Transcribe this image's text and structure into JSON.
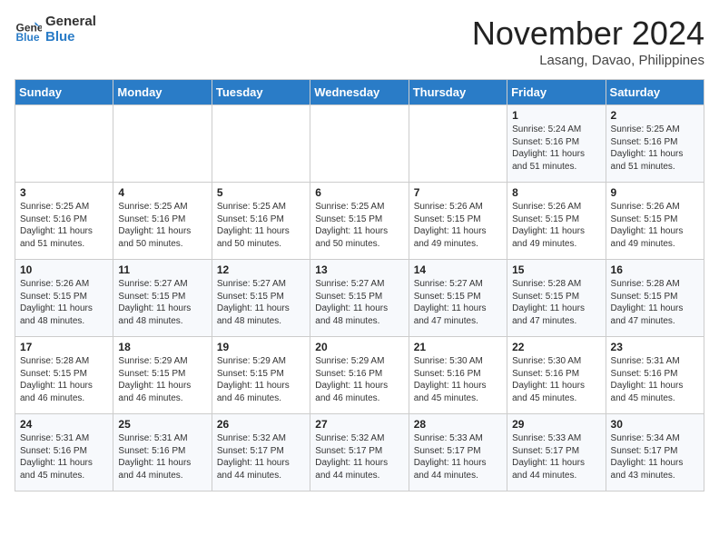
{
  "header": {
    "logo_text_general": "General",
    "logo_text_blue": "Blue",
    "month_title": "November 2024",
    "location": "Lasang, Davao, Philippines"
  },
  "weekdays": [
    "Sunday",
    "Monday",
    "Tuesday",
    "Wednesday",
    "Thursday",
    "Friday",
    "Saturday"
  ],
  "weeks": [
    [
      {
        "day": "",
        "info": ""
      },
      {
        "day": "",
        "info": ""
      },
      {
        "day": "",
        "info": ""
      },
      {
        "day": "",
        "info": ""
      },
      {
        "day": "",
        "info": ""
      },
      {
        "day": "1",
        "info": "Sunrise: 5:24 AM\nSunset: 5:16 PM\nDaylight: 11 hours\nand 51 minutes."
      },
      {
        "day": "2",
        "info": "Sunrise: 5:25 AM\nSunset: 5:16 PM\nDaylight: 11 hours\nand 51 minutes."
      }
    ],
    [
      {
        "day": "3",
        "info": "Sunrise: 5:25 AM\nSunset: 5:16 PM\nDaylight: 11 hours\nand 51 minutes."
      },
      {
        "day": "4",
        "info": "Sunrise: 5:25 AM\nSunset: 5:16 PM\nDaylight: 11 hours\nand 50 minutes."
      },
      {
        "day": "5",
        "info": "Sunrise: 5:25 AM\nSunset: 5:16 PM\nDaylight: 11 hours\nand 50 minutes."
      },
      {
        "day": "6",
        "info": "Sunrise: 5:25 AM\nSunset: 5:15 PM\nDaylight: 11 hours\nand 50 minutes."
      },
      {
        "day": "7",
        "info": "Sunrise: 5:26 AM\nSunset: 5:15 PM\nDaylight: 11 hours\nand 49 minutes."
      },
      {
        "day": "8",
        "info": "Sunrise: 5:26 AM\nSunset: 5:15 PM\nDaylight: 11 hours\nand 49 minutes."
      },
      {
        "day": "9",
        "info": "Sunrise: 5:26 AM\nSunset: 5:15 PM\nDaylight: 11 hours\nand 49 minutes."
      }
    ],
    [
      {
        "day": "10",
        "info": "Sunrise: 5:26 AM\nSunset: 5:15 PM\nDaylight: 11 hours\nand 48 minutes."
      },
      {
        "day": "11",
        "info": "Sunrise: 5:27 AM\nSunset: 5:15 PM\nDaylight: 11 hours\nand 48 minutes."
      },
      {
        "day": "12",
        "info": "Sunrise: 5:27 AM\nSunset: 5:15 PM\nDaylight: 11 hours\nand 48 minutes."
      },
      {
        "day": "13",
        "info": "Sunrise: 5:27 AM\nSunset: 5:15 PM\nDaylight: 11 hours\nand 48 minutes."
      },
      {
        "day": "14",
        "info": "Sunrise: 5:27 AM\nSunset: 5:15 PM\nDaylight: 11 hours\nand 47 minutes."
      },
      {
        "day": "15",
        "info": "Sunrise: 5:28 AM\nSunset: 5:15 PM\nDaylight: 11 hours\nand 47 minutes."
      },
      {
        "day": "16",
        "info": "Sunrise: 5:28 AM\nSunset: 5:15 PM\nDaylight: 11 hours\nand 47 minutes."
      }
    ],
    [
      {
        "day": "17",
        "info": "Sunrise: 5:28 AM\nSunset: 5:15 PM\nDaylight: 11 hours\nand 46 minutes."
      },
      {
        "day": "18",
        "info": "Sunrise: 5:29 AM\nSunset: 5:15 PM\nDaylight: 11 hours\nand 46 minutes."
      },
      {
        "day": "19",
        "info": "Sunrise: 5:29 AM\nSunset: 5:15 PM\nDaylight: 11 hours\nand 46 minutes."
      },
      {
        "day": "20",
        "info": "Sunrise: 5:29 AM\nSunset: 5:16 PM\nDaylight: 11 hours\nand 46 minutes."
      },
      {
        "day": "21",
        "info": "Sunrise: 5:30 AM\nSunset: 5:16 PM\nDaylight: 11 hours\nand 45 minutes."
      },
      {
        "day": "22",
        "info": "Sunrise: 5:30 AM\nSunset: 5:16 PM\nDaylight: 11 hours\nand 45 minutes."
      },
      {
        "day": "23",
        "info": "Sunrise: 5:31 AM\nSunset: 5:16 PM\nDaylight: 11 hours\nand 45 minutes."
      }
    ],
    [
      {
        "day": "24",
        "info": "Sunrise: 5:31 AM\nSunset: 5:16 PM\nDaylight: 11 hours\nand 45 minutes."
      },
      {
        "day": "25",
        "info": "Sunrise: 5:31 AM\nSunset: 5:16 PM\nDaylight: 11 hours\nand 44 minutes."
      },
      {
        "day": "26",
        "info": "Sunrise: 5:32 AM\nSunset: 5:17 PM\nDaylight: 11 hours\nand 44 minutes."
      },
      {
        "day": "27",
        "info": "Sunrise: 5:32 AM\nSunset: 5:17 PM\nDaylight: 11 hours\nand 44 minutes."
      },
      {
        "day": "28",
        "info": "Sunrise: 5:33 AM\nSunset: 5:17 PM\nDaylight: 11 hours\nand 44 minutes."
      },
      {
        "day": "29",
        "info": "Sunrise: 5:33 AM\nSunset: 5:17 PM\nDaylight: 11 hours\nand 44 minutes."
      },
      {
        "day": "30",
        "info": "Sunrise: 5:34 AM\nSunset: 5:17 PM\nDaylight: 11 hours\nand 43 minutes."
      }
    ]
  ]
}
